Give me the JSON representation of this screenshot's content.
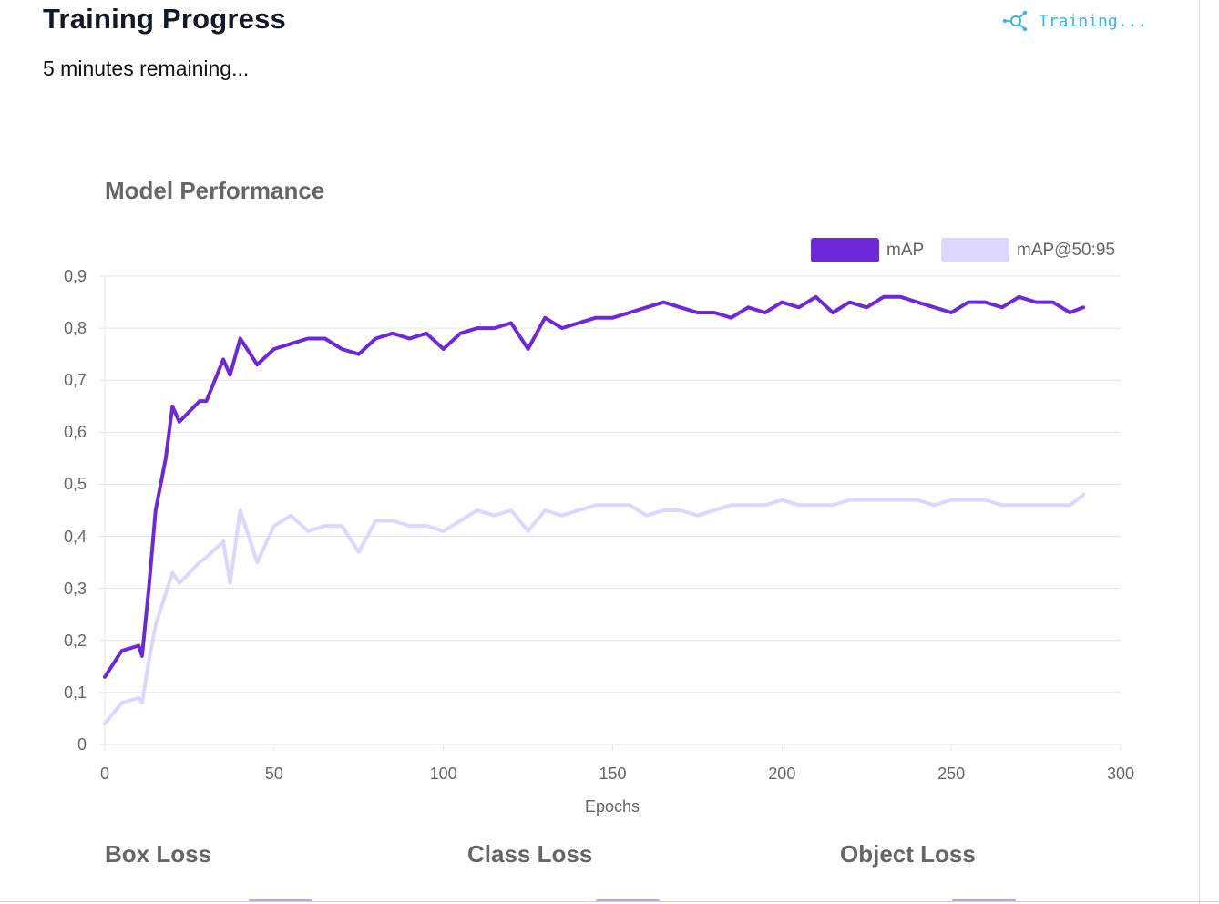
{
  "header": {
    "title": "Training Progress",
    "status_text": "Training...",
    "status_icon": "network-icon",
    "status_color": "#38b6e8",
    "remaining_text": "5 minutes remaining..."
  },
  "chart_data": {
    "type": "line",
    "title": "Model Performance",
    "xlabel": "Epochs",
    "ylabel": "",
    "xlim": [
      0,
      300
    ],
    "ylim": [
      0,
      0.9
    ],
    "x_ticks": [
      "0",
      "50",
      "100",
      "150",
      "200",
      "250",
      "300"
    ],
    "y_ticks": [
      "0",
      "0,1",
      "0,2",
      "0,3",
      "0,4",
      "0,5",
      "0,6",
      "0,7",
      "0,8",
      "0,9"
    ],
    "grid": true,
    "legend_position": "top-right",
    "x": [
      0,
      5,
      10,
      11,
      13,
      15,
      18,
      20,
      22,
      25,
      28,
      30,
      35,
      37,
      40,
      45,
      50,
      55,
      60,
      65,
      70,
      75,
      80,
      85,
      90,
      95,
      100,
      105,
      110,
      115,
      120,
      125,
      130,
      135,
      140,
      145,
      150,
      155,
      160,
      165,
      170,
      175,
      180,
      185,
      190,
      195,
      200,
      205,
      210,
      215,
      220,
      225,
      230,
      235,
      240,
      245,
      250,
      255,
      260,
      265,
      270,
      275,
      280,
      285,
      289
    ],
    "series": [
      {
        "name": "mAP",
        "color": "#6d28d9",
        "values": [
          0.13,
          0.18,
          0.19,
          0.17,
          0.3,
          0.45,
          0.55,
          0.65,
          0.62,
          0.64,
          0.66,
          0.66,
          0.74,
          0.71,
          0.78,
          0.73,
          0.76,
          0.77,
          0.78,
          0.78,
          0.76,
          0.75,
          0.78,
          0.79,
          0.78,
          0.79,
          0.76,
          0.79,
          0.8,
          0.8,
          0.81,
          0.76,
          0.82,
          0.8,
          0.81,
          0.82,
          0.82,
          0.83,
          0.84,
          0.85,
          0.84,
          0.83,
          0.83,
          0.82,
          0.84,
          0.83,
          0.85,
          0.84,
          0.86,
          0.83,
          0.85,
          0.84,
          0.86,
          0.86,
          0.85,
          0.84,
          0.83,
          0.85,
          0.85,
          0.84,
          0.86,
          0.85,
          0.85,
          0.83,
          0.84
        ]
      },
      {
        "name": "mAP@50:95",
        "color": "#ddd6fe",
        "values": [
          0.04,
          0.08,
          0.09,
          0.08,
          0.16,
          0.23,
          0.29,
          0.33,
          0.31,
          0.33,
          0.35,
          0.36,
          0.39,
          0.31,
          0.45,
          0.35,
          0.42,
          0.44,
          0.41,
          0.42,
          0.42,
          0.37,
          0.43,
          0.43,
          0.42,
          0.42,
          0.41,
          0.43,
          0.45,
          0.44,
          0.45,
          0.41,
          0.45,
          0.44,
          0.45,
          0.46,
          0.46,
          0.46,
          0.44,
          0.45,
          0.45,
          0.44,
          0.45,
          0.46,
          0.46,
          0.46,
          0.47,
          0.46,
          0.46,
          0.46,
          0.47,
          0.47,
          0.47,
          0.47,
          0.47,
          0.46,
          0.47,
          0.47,
          0.47,
          0.46,
          0.46,
          0.46,
          0.46,
          0.46,
          0.48
        ]
      }
    ]
  },
  "subcharts": {
    "box_loss_title": "Box Loss",
    "class_loss_title": "Class Loss",
    "object_loss_title": "Object Loss"
  }
}
